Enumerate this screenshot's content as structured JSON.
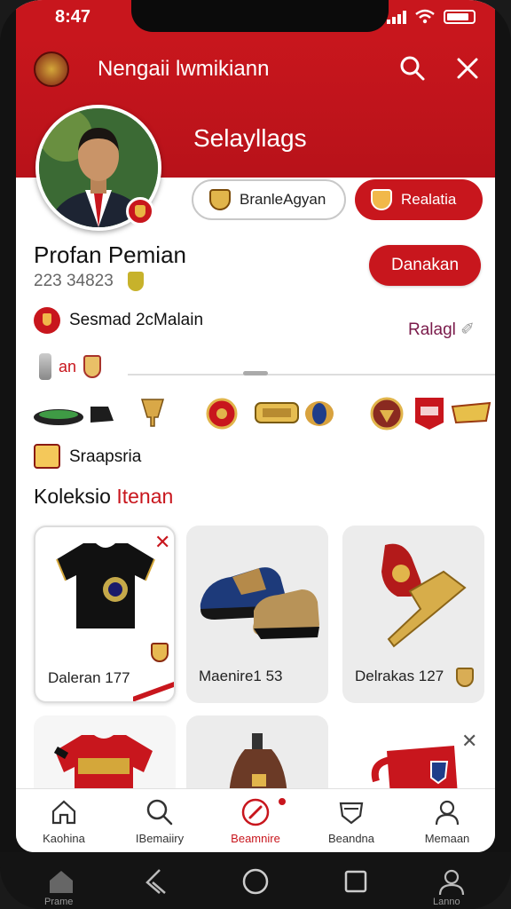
{
  "status_bar": {
    "time": "8:47"
  },
  "header": {
    "app_title": "Nengaii lwmikiann",
    "heading": "Selayllags"
  },
  "profile": {
    "league_label": "BranleAgyan",
    "team_label": "Realatia",
    "name": "Profan Pemian",
    "id": "223 34823",
    "follow_label": "Danakan"
  },
  "season": {
    "label": "Sesmad 2cMalain",
    "history_link": "Ralagl",
    "mini_label": "an"
  },
  "sponsor": {
    "label": "Sraapsria"
  },
  "collection": {
    "title": "Koleksio",
    "title_accent": "Itenan",
    "items": [
      {
        "label": "Daleran 177"
      },
      {
        "label": "Maenire1 53"
      },
      {
        "label": "Delrakas 127"
      }
    ]
  },
  "bottom_nav": [
    {
      "label": "Kaohina",
      "icon": "home-icon"
    },
    {
      "label": "IBemaiiry",
      "icon": "search-icon"
    },
    {
      "label": "Beamnire",
      "icon": "whistle-icon"
    },
    {
      "label": "Beandna",
      "icon": "shield-icon"
    },
    {
      "label": "Memaan",
      "icon": "profile-icon"
    }
  ],
  "system_nav": {
    "home_label": "Prame",
    "profile_label": "Lanno"
  },
  "colors": {
    "brand_red": "#c8161d",
    "gold": "#e1b54b"
  }
}
